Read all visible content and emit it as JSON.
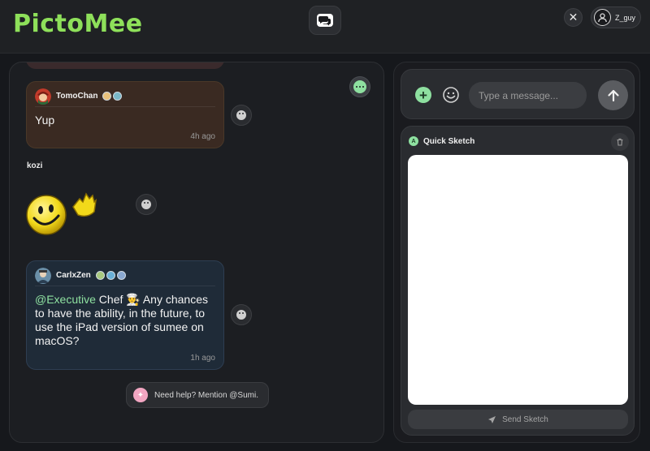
{
  "app": {
    "logo": "PictoMee"
  },
  "header": {
    "user": {
      "name": "Z_guy"
    },
    "icons": {
      "center": "chat-bubbles-icon",
      "close": "close-icon",
      "avatar": "user-avatar-icon"
    }
  },
  "chat": {
    "messages": [
      {
        "user": "TomoChan",
        "text": "Yup",
        "time": "4h ago"
      },
      {
        "label": "kozi"
      },
      {
        "user": "CarlxZen",
        "mention": "@Executive",
        "text": " Chef 👨‍🍳 Any chances to have the ability, in the future, to use the iPad version of sumee on macOS?",
        "time": "1h ago"
      }
    ],
    "help": {
      "text": "Need help? Mention @Sumi."
    }
  },
  "composer": {
    "placeholder": "Type a message..."
  },
  "sketch": {
    "title": "Quick Sketch",
    "send_label": "Send Sketch"
  },
  "colors": {
    "accent": "#8ee05a",
    "mint": "#8ee0a0",
    "background": "#16181c"
  }
}
